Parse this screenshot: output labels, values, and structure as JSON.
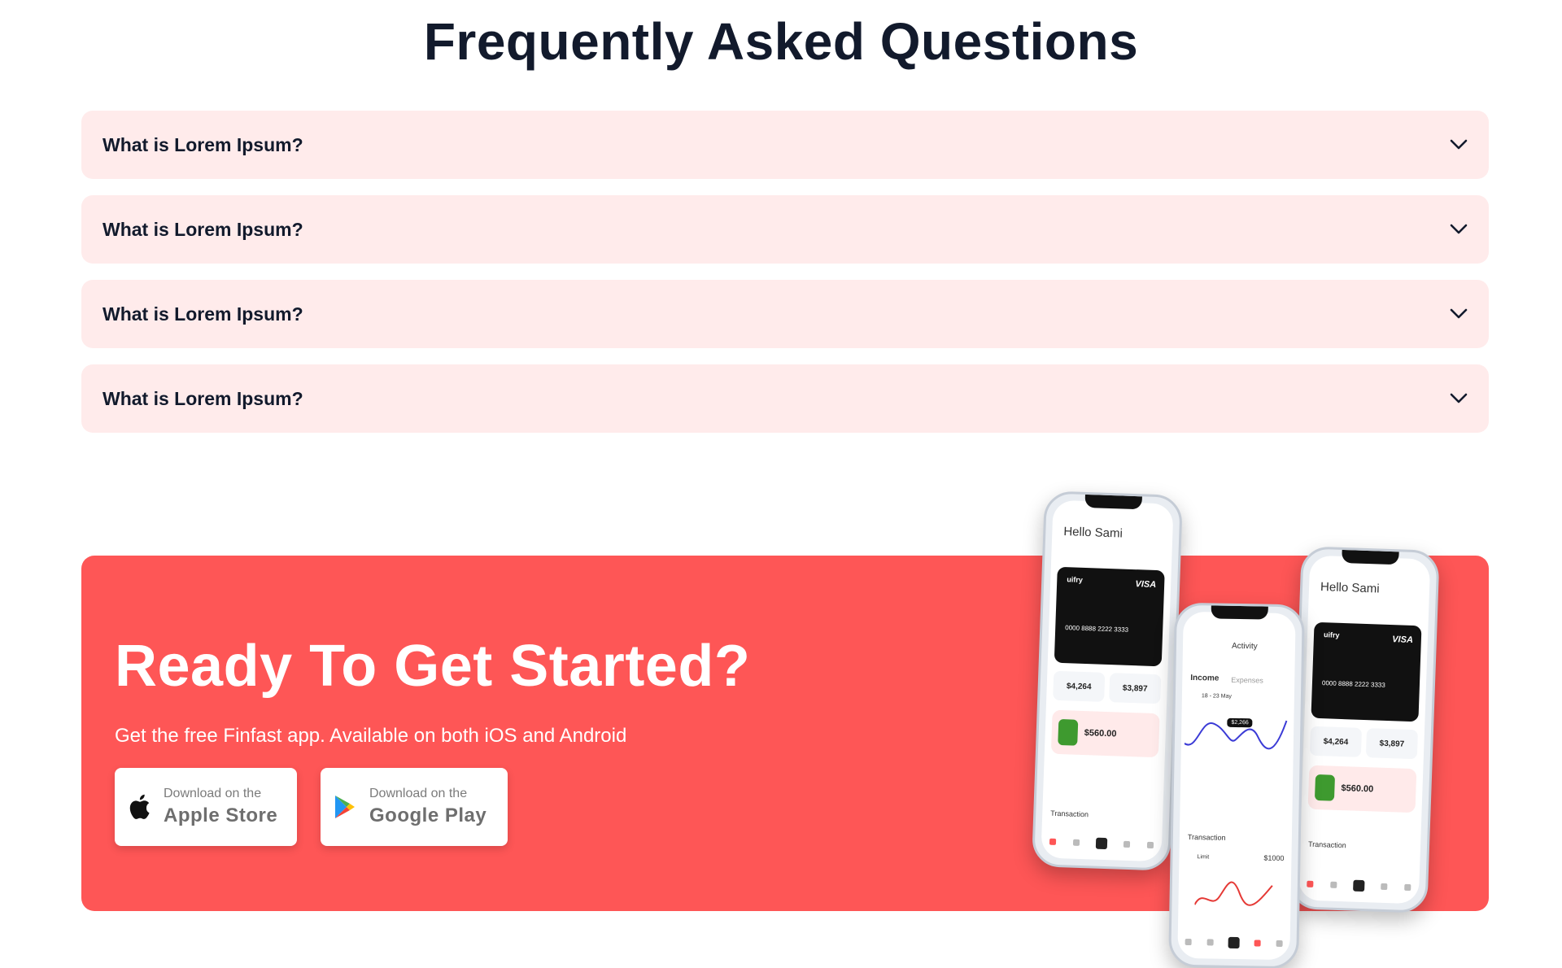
{
  "faq": {
    "title": "Frequently Asked Questions",
    "items": [
      {
        "question": "What is Lorem Ipsum?"
      },
      {
        "question": "What is Lorem Ipsum?"
      },
      {
        "question": "What is Lorem Ipsum?"
      },
      {
        "question": "What is Lorem Ipsum?"
      }
    ],
    "icon": "chevron-down-icon"
  },
  "cta": {
    "title": "Ready To Get Started?",
    "subtitle": "Get the free Finfast app. Available on both iOS and Android",
    "apple": {
      "small": "Download on the",
      "big": "Apple Store",
      "icon": "apple-icon"
    },
    "google": {
      "small": "Download on the",
      "big": "Google Play",
      "icon": "google-play-icon"
    }
  },
  "phones": {
    "greeting": "Hello Sami",
    "card_brand": "uifry",
    "card_network": "VISA",
    "card_number": "0000 8888 2222 3333",
    "expense": "$4,264",
    "income": "$3,897",
    "transaction_amount": "$560.00",
    "transaction_label": "Transaction",
    "activity_title": "Activity",
    "income_tab": "Income",
    "expenses_tab": "Expenses",
    "date_range": "18 - 23 May",
    "limit_label": "Limit",
    "limit_value": "$1000",
    "chart_tag": "$2,266"
  },
  "colors": {
    "accent": "#fe5656",
    "faq_bg": "#ffebeb",
    "heading": "#121a2c"
  }
}
